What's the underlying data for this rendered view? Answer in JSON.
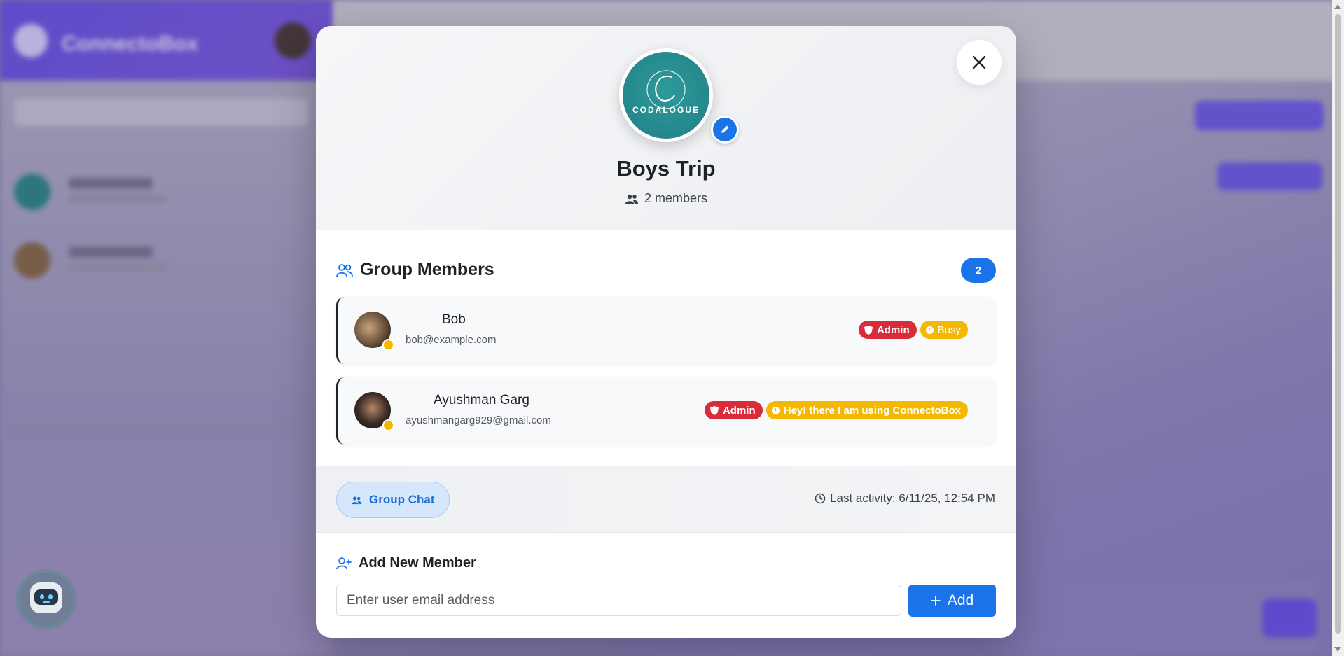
{
  "background": {
    "brand": "ConnectoBox"
  },
  "modal": {
    "group_logo_text": "CODALOGUE",
    "group_name": "Boys Trip",
    "member_count": "2 members",
    "members_section_title": "Group Members",
    "members_count_badge": "2",
    "members": [
      {
        "name": "Bob",
        "email": "bob@example.com",
        "role": "Admin",
        "status": "Busy",
        "status_color": "#f5b800"
      },
      {
        "name": "Ayushman Garg",
        "email": "ayushmangarg929@gmail.com",
        "role": "Admin",
        "status": "Hey! there I am using ConnectoBox",
        "status_color": "#f5b800"
      }
    ],
    "chip_label": "Group Chat",
    "last_activity": "Last activity: 6/11/25, 12:54 PM",
    "add_section_title": "Add New Member",
    "add_input_placeholder": "Enter user email address",
    "add_button_label": "Add"
  },
  "colors": {
    "accent": "#1a73e8",
    "admin": "#d92c3a",
    "busy": "#f5b800"
  },
  "icons": [
    "close-icon",
    "pencil-icon",
    "members-icon",
    "group-members-icon",
    "shield-icon",
    "clock-icon",
    "user-plus-icon",
    "plus-icon",
    "bot-icon"
  ]
}
